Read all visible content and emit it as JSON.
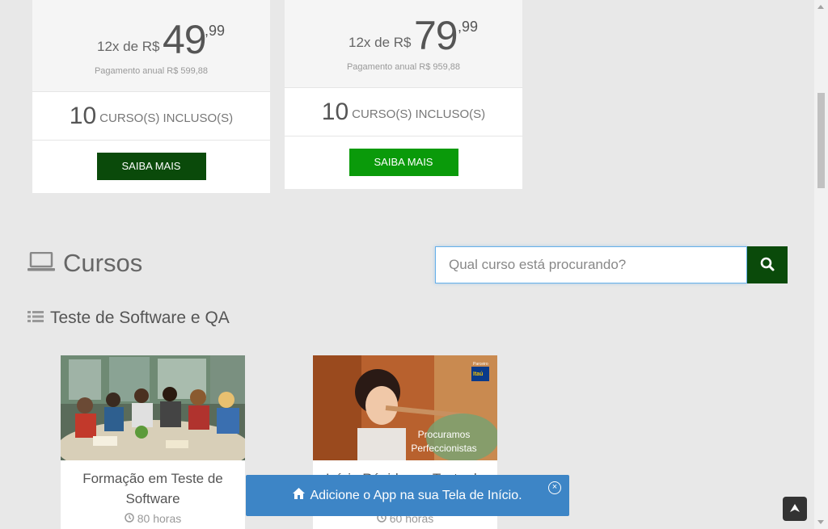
{
  "plans": [
    {
      "installments": "12x de R$",
      "price": "49",
      "cents": ",99",
      "annual": "Pagamento anual R$ 599,88",
      "courses_count": "10",
      "courses_label": "CURSO(S) INCLUSO(S)",
      "button": "SAIBA MAIS",
      "button_color": "#0a4a0a"
    },
    {
      "installments": "12x de R$",
      "price": "79",
      "cents": ",99",
      "annual": "Pagamento anual R$ 959,88",
      "courses_count": "10",
      "courses_label": "CURSO(S) INCLUSO(S)",
      "button": "SAIBA MAIS",
      "button_color": "#0a9a0a"
    }
  ],
  "section": {
    "title": "Cursos",
    "icon": "laptop-icon"
  },
  "search": {
    "placeholder": "Qual curso está procurando?",
    "button_icon": "search-icon"
  },
  "category": {
    "title": "Teste de Software e QA",
    "icon": "list-icon"
  },
  "courses": [
    {
      "title": "Formação em Teste de Software",
      "hours": "80 horas"
    },
    {
      "title": "Início Rápido em Teste de",
      "hours": "60 horas",
      "image_caption": "Procuramos Perfeccionistas",
      "badge_label": "Parceiro",
      "badge_text": "Itaú"
    }
  ],
  "toast": {
    "text": "Adicione o App na sua Tela de Início.",
    "icon": "home-icon",
    "close": "×"
  },
  "colors": {
    "accent_dark": "#0a4a0a",
    "accent_bright": "#0a9a0a",
    "toast": "#3d85c6"
  }
}
